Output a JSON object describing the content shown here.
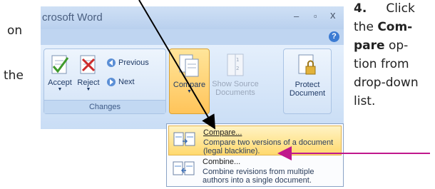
{
  "instruction": {
    "left_word1": "on",
    "left_word2": "the",
    "step_number": "4.",
    "step_text_1": "Click",
    "step_text_2": "the",
    "step_bold_1": "Com-",
    "step_bold_2": "pare",
    "step_text_3": "op-",
    "step_text_4": "tion from",
    "step_text_5": "drop-down",
    "step_text_6": "list."
  },
  "window": {
    "title": "crosoft Word",
    "minimize": "–",
    "maximize": "▫",
    "close": "x",
    "help": "?"
  },
  "ribbon": {
    "changes_group": {
      "label": "Changes",
      "accept": "Accept",
      "reject": "Reject",
      "previous": "Previous",
      "next": "Next"
    },
    "compare_label": "Compare",
    "show_source_line1": "Show Source",
    "show_source_line2": "Documents",
    "protect_line1": "Protect",
    "protect_line2": "Document"
  },
  "menu": {
    "items": [
      {
        "title": "Compare...",
        "description": "Compare two versions of a document (legal blackline)."
      },
      {
        "title": "Combine...",
        "description": "Combine revisions from multiple authors into a single document."
      }
    ]
  },
  "colors": {
    "annotation_arrow": "#c0188c",
    "pointer_arrow": "#000000"
  }
}
